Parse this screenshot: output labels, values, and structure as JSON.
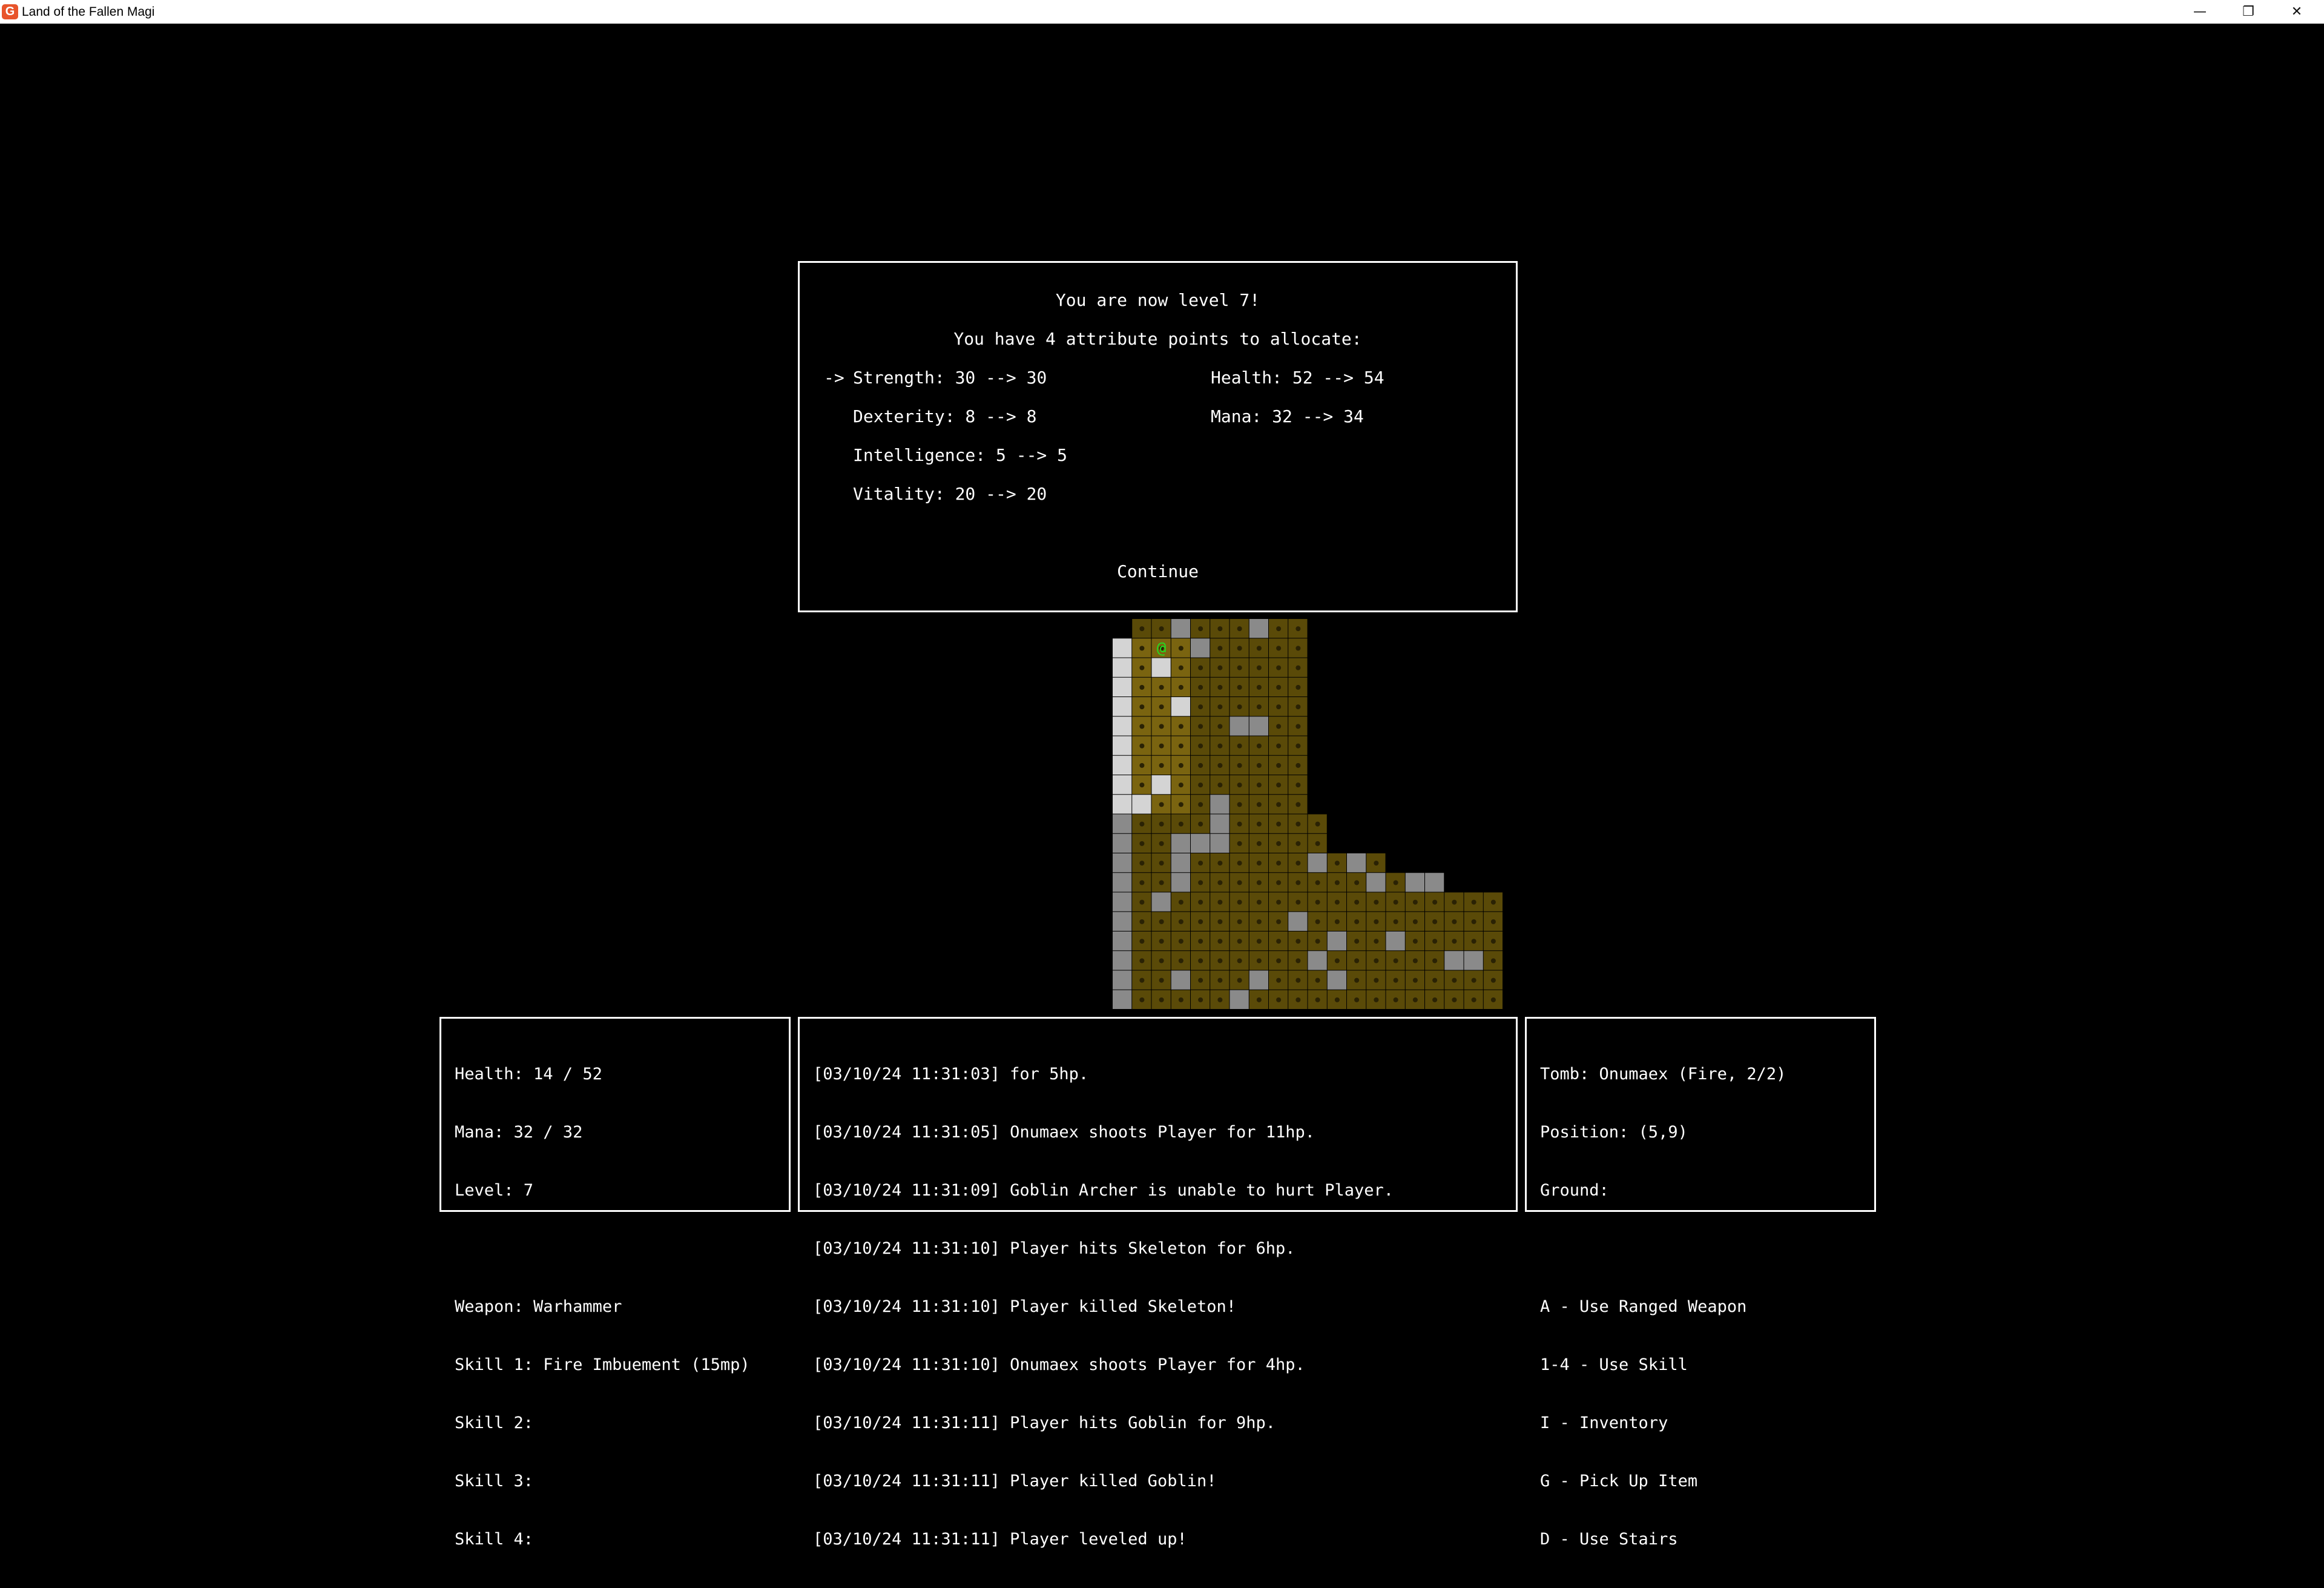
{
  "window": {
    "title": "Land of the Fallen Magi",
    "icon": "game-app-icon",
    "controls": [
      "minimize",
      "restore",
      "close"
    ]
  },
  "level_up_dialog": {
    "heading": "You are now level 7!",
    "subheading": "You have 4 attribute points to allocate:",
    "cursor": "->",
    "attributes": [
      {
        "label": "Strength: 30 --> 30",
        "selected": true
      },
      {
        "label": "Dexterity: 8 --> 8",
        "selected": false
      },
      {
        "label": "Intelligence: 5 --> 5",
        "selected": false
      },
      {
        "label": "Vitality: 20 --> 20",
        "selected": false
      }
    ],
    "derived": [
      {
        "label": "Health: 52 --> 54"
      },
      {
        "label": "Mana: 32 --> 34"
      }
    ],
    "continue_label": "Continue"
  },
  "status_panel": {
    "lines": [
      "Health: 14 / 52",
      "Mana: 32 / 32",
      "Level: 7",
      "",
      "Weapon: Warhammer",
      "Skill 1: Fire Imbuement (15mp)",
      "Skill 2:",
      "Skill 3:",
      "Skill 4:"
    ]
  },
  "log_panel": {
    "lines": [
      "[03/10/24 11:31:03] for 5hp.",
      "[03/10/24 11:31:05] Onumaex shoots Player for 11hp.",
      "[03/10/24 11:31:09] Goblin Archer is unable to hurt Player.",
      "[03/10/24 11:31:10] Player hits Skeleton for 6hp.",
      "[03/10/24 11:31:10] Player killed Skeleton!",
      "[03/10/24 11:31:10] Onumaex shoots Player for 4hp.",
      "[03/10/24 11:31:11] Player hits Goblin for 9hp.",
      "[03/10/24 11:31:11] Player killed Goblin!",
      "[03/10/24 11:31:11] Player leveled up!"
    ]
  },
  "info_panel": {
    "lines": [
      "Tomb: Onumaex (Fire, 2/2)",
      "Position: (5,9)",
      "Ground:",
      "",
      "A - Use Ranged Weapon",
      "1-4 - Use Skill",
      "I - Inventory",
      "G - Pick Up Item",
      "D - Use Stairs"
    ]
  },
  "map": {
    "player_glyph": "@",
    "colors": {
      "floor": "#5a4a08",
      "floor_lit": "#7a6410",
      "wall": "#8a8a8a",
      "wall_lit": "#d4d4d4",
      "player": "#22dd22"
    }
  }
}
